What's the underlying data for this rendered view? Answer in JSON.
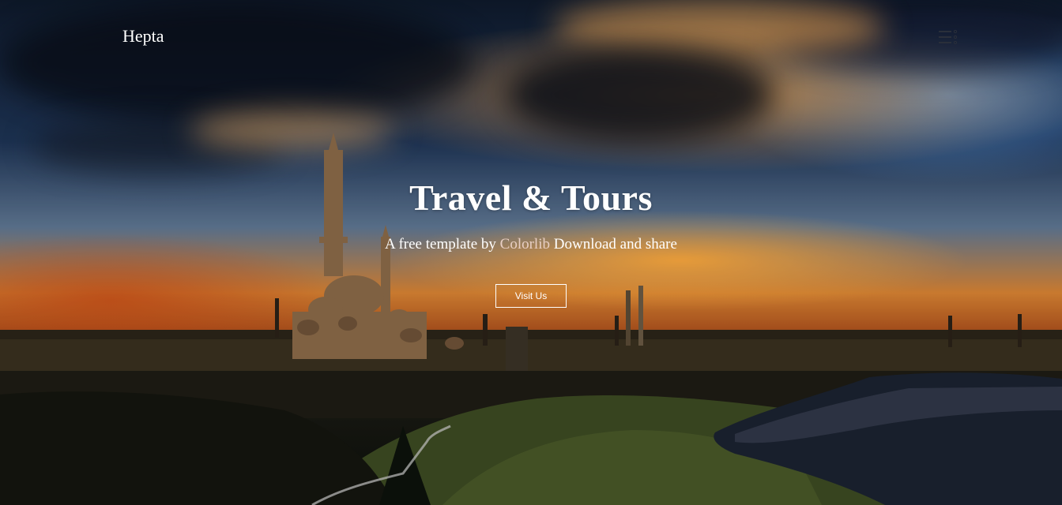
{
  "nav": {
    "brand": "Hepta",
    "menu_icon": "hamburger-dots-icon"
  },
  "hero": {
    "title": "Travel & Tours",
    "subtitle_prefix": "A free template by ",
    "subtitle_link": "Colorlib",
    "subtitle_suffix": " Download and share",
    "button_label": "Visit Us"
  },
  "colors": {
    "text": "#ffffff",
    "link": "#e8cfc4",
    "sky_orange": "#d98433",
    "sky_dark": "#0f1a2b"
  }
}
